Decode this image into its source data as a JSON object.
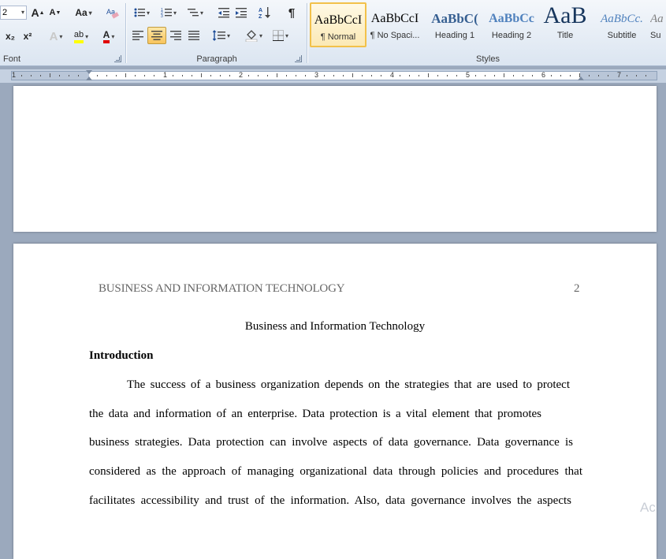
{
  "ribbon": {
    "font": {
      "size_value": "2",
      "grow_label": "A",
      "shrink_label": "A",
      "case_label": "Aa",
      "subscript_label": "x₂",
      "superscript_label": "x²",
      "highlight_label": "ab",
      "font_color_label": "A",
      "group_label": "Font"
    },
    "paragraph": {
      "group_label": "Paragraph",
      "pilcrow": "¶"
    },
    "styles": {
      "group_label": "Styles",
      "tiles": [
        {
          "sample": "AaBbCcI",
          "name": "¶ Normal",
          "color": "#000000"
        },
        {
          "sample": "AaBbCcI",
          "name": "¶ No Spaci...",
          "color": "#000000"
        },
        {
          "sample": "AaBbC(",
          "name": "Heading 1",
          "color": "#365f91"
        },
        {
          "sample": "AaBbCc",
          "name": "Heading 2",
          "color": "#4f81bd"
        },
        {
          "sample": "AaB",
          "name": "Title",
          "color": "#17365d"
        },
        {
          "sample": "AaBbCc.",
          "name": "Subtitle",
          "color": "#4f81bd"
        },
        {
          "sample": "Aa",
          "name": "Su",
          "color": "#7f7f7f"
        }
      ]
    }
  },
  "ruler": {
    "numbers": [
      "1",
      "1",
      "2",
      "3",
      "4",
      "5",
      "6",
      "7"
    ]
  },
  "document": {
    "running_head": "BUSINESS AND INFORMATION TECHNOLOGY",
    "page_number": "2",
    "title": "Business and Information Technology",
    "heading": "Introduction",
    "lines": [
      "The success of a business organization depends on the strategies that are used to protect",
      "the data and information of an enterprise. Data protection is a vital element that promotes",
      "business strategies. Data protection can involve aspects of data governance. Data governance is",
      "considered as the approach of managing organizational data through policies and procedures that",
      "facilitates accessibility and trust of the information. Also, data governance involves the aspects"
    ]
  },
  "watermark": "Ac",
  "colors": {
    "ribbon_bg": "#dbe5f1",
    "workspace": "#9ba9bd",
    "selected_style": "#f2c14a"
  }
}
